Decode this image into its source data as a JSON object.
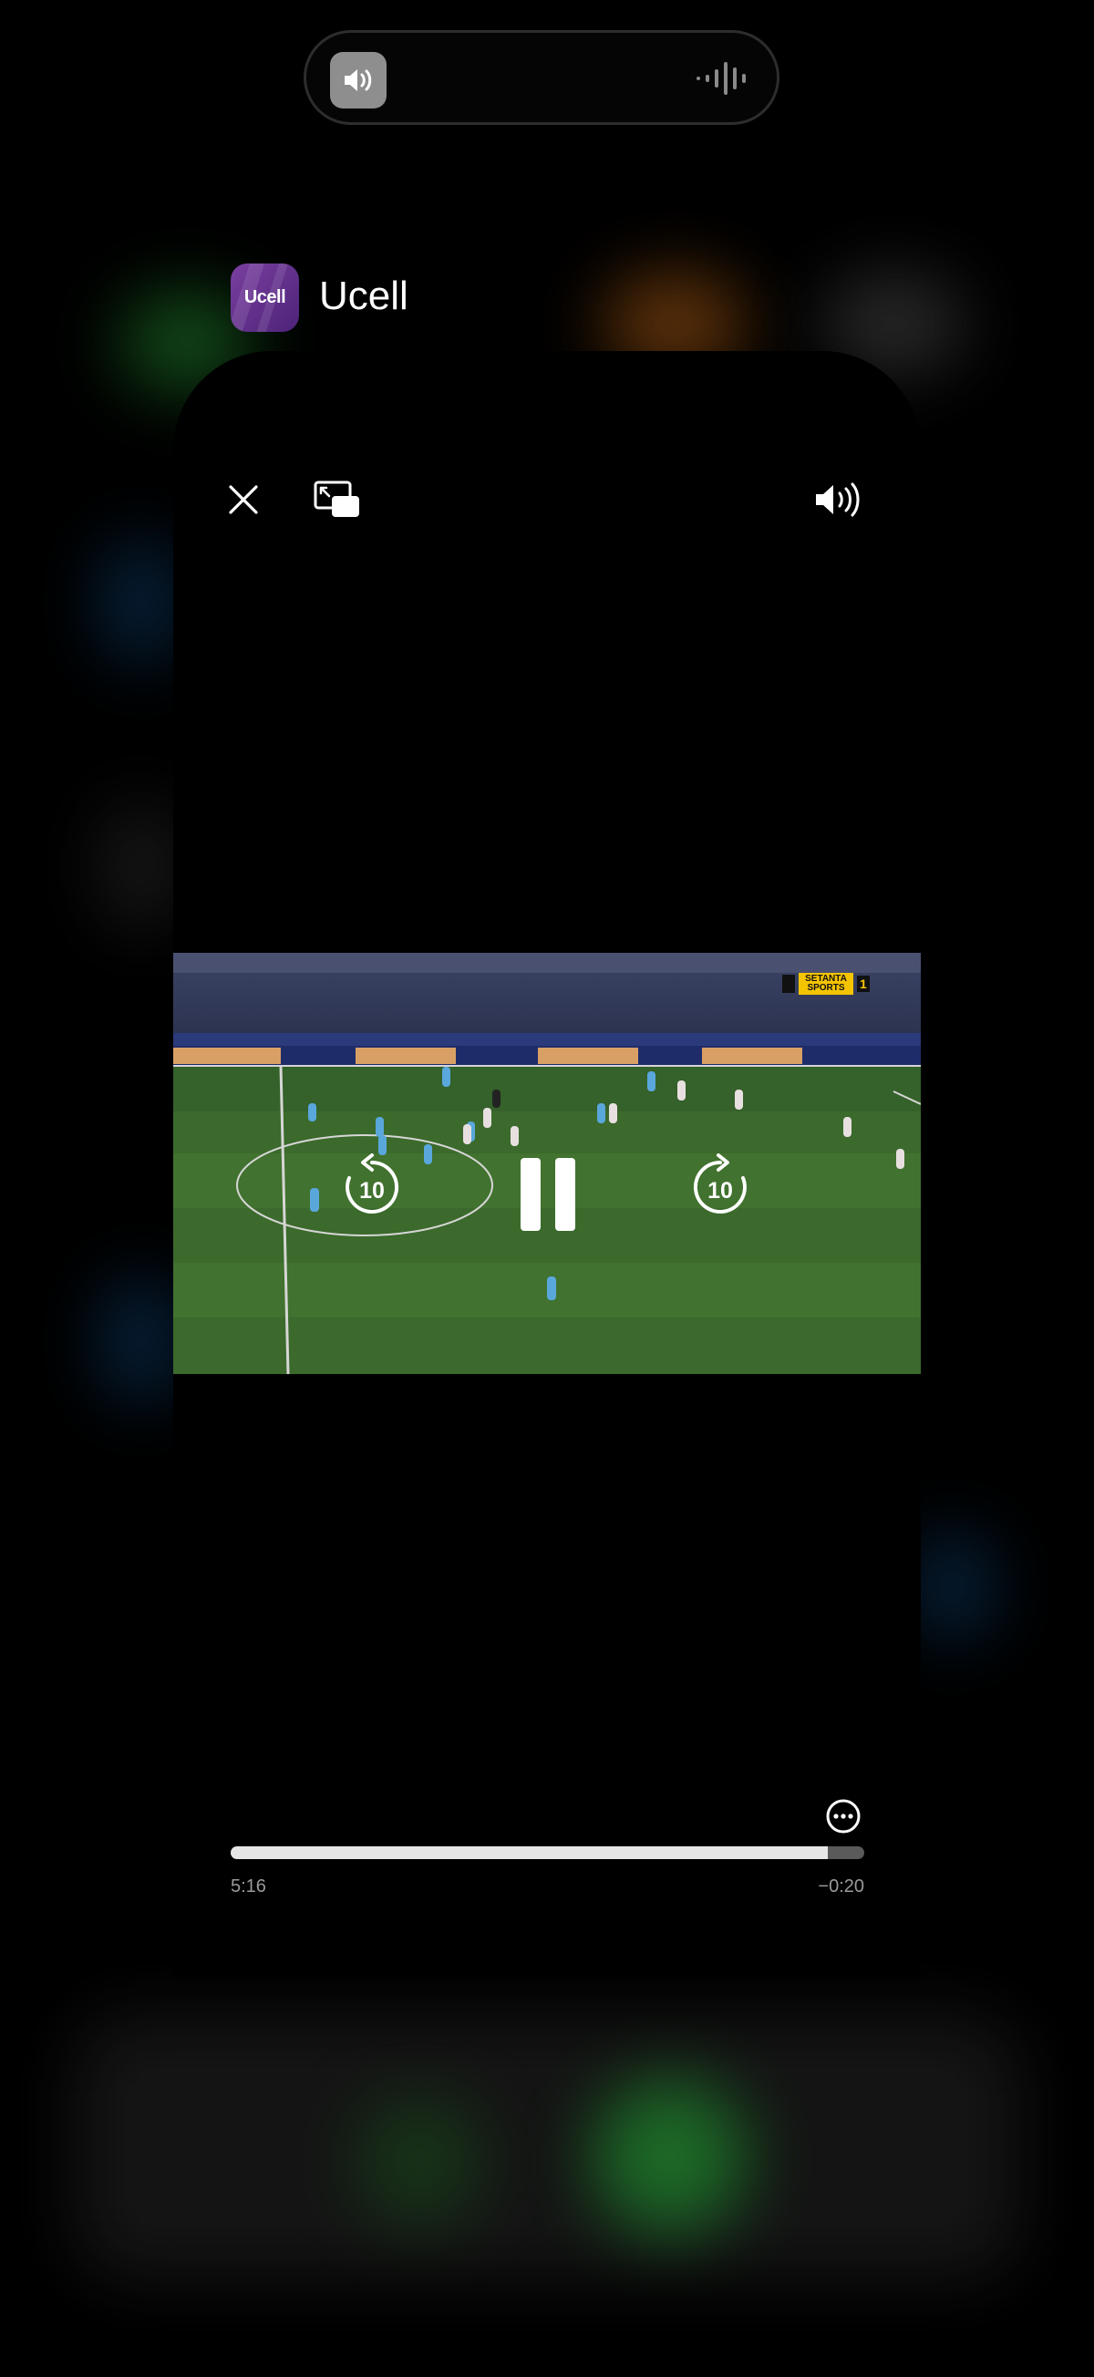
{
  "island": {
    "left_icon": "speaker-icon",
    "right_icon": "waveform-icon"
  },
  "app": {
    "name": "Ucell",
    "icon_label": "Ucell",
    "icon_color": "#5b2a86"
  },
  "player": {
    "top_controls": [
      "close-icon",
      "picture-in-picture-icon",
      "volume-icon"
    ],
    "center_controls": [
      "skip-back-10-icon",
      "pause-icon",
      "skip-forward-10-icon"
    ],
    "skip_back_label": "10",
    "skip_forward_label": "10",
    "broadcaster_badge": "SETANTA SPORTS",
    "broadcaster_channel": "1",
    "more_icon": "ellipsis-circle-icon",
    "progress": 0.943,
    "elapsed": "5:16",
    "remaining": "−0:20"
  },
  "colors": {
    "background": "#000000",
    "progress_fill": "#e6e6e6",
    "progress_track": "#5a5a5a",
    "badge": "#f5c400"
  }
}
